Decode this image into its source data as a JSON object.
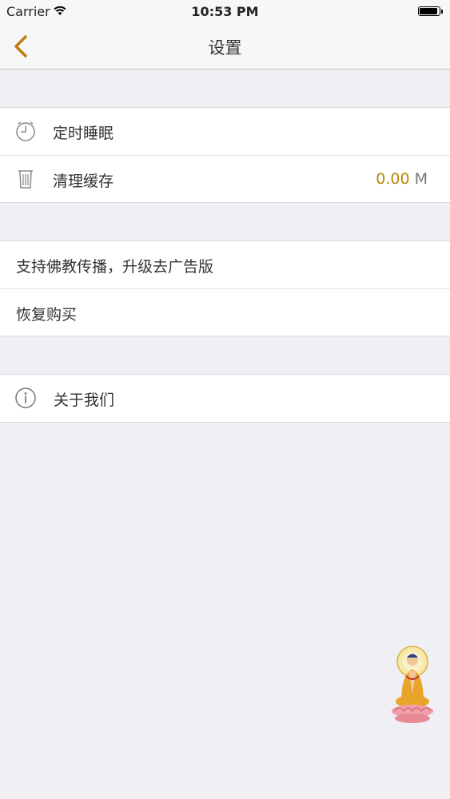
{
  "status_bar": {
    "carrier": "Carrier",
    "time": "10:53 PM"
  },
  "nav": {
    "title": "设置",
    "back_icon": "chevron-left-icon"
  },
  "settings": {
    "group1": [
      {
        "label": "定时睡眠",
        "icon": "alarm-clock-icon"
      },
      {
        "label": "清理缓存",
        "icon": "trash-icon",
        "value": "0.00",
        "unit": "M"
      }
    ],
    "group2": [
      {
        "label": "支持佛教传播，升级去广告版"
      },
      {
        "label": "恢复购买"
      }
    ],
    "group3": [
      {
        "label": "关于我们",
        "icon": "info-icon"
      }
    ]
  },
  "colors": {
    "accent": "#c07a14",
    "background": "#efeff4"
  },
  "floating": {
    "icon": "buddha-icon"
  }
}
